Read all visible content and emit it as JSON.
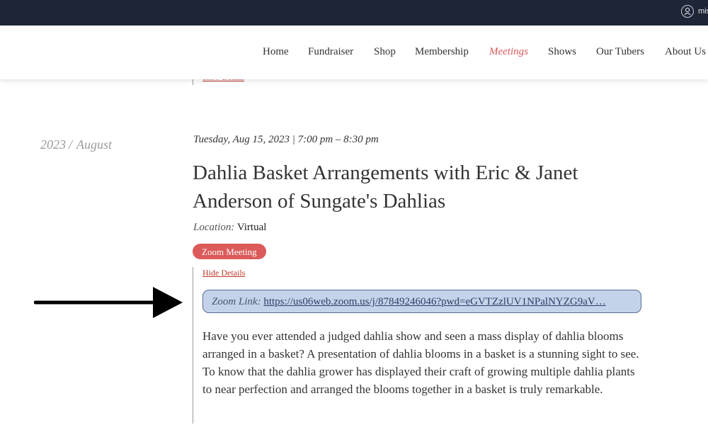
{
  "topbar": {
    "account_text": "mis"
  },
  "nav": {
    "items": [
      {
        "label": "Home"
      },
      {
        "label": "Fundraiser"
      },
      {
        "label": "Shop"
      },
      {
        "label": "Membership"
      },
      {
        "label": "Meetings",
        "active": true
      },
      {
        "label": "Shows"
      },
      {
        "label": "Our Tubers"
      },
      {
        "label": "About Us"
      }
    ]
  },
  "previous_event": {
    "details_link": "Show Details"
  },
  "date_column": {
    "year": "2023",
    "separator": "/",
    "month": "August"
  },
  "event": {
    "datetime": "Tuesday, Aug 15, 2023 | 7:00 pm – 8:30 pm",
    "title": "Dahlia Basket Arrangements with Eric & Janet Anderson of Sungate's Dahlias",
    "location_label": "Location:",
    "location_value": "Virtual",
    "badge": "Zoom Meeting",
    "hide_details": "Hide Details",
    "zoom_label": "Zoom Link:",
    "zoom_url": "https://us06web.zoom.us/j/87849246046?pwd=eGVTZzlUV1NPalNYZG9aV…",
    "description": "Have you ever attended a judged dahlia show and seen a mass display of dahlia blooms arranged in a basket? A presentation of dahlia blooms in a basket is a stunning sight to see. To know that the dahlia grower has displayed their craft of growing multiple dahlia plants to near perfection and arranged the blooms together in a basket is truly remarkable."
  },
  "colors": {
    "topbar": "#1d2536",
    "accent": "#d9565a",
    "badge": "#dc5a5a",
    "zoom_box_bg": "#c5d3ea",
    "zoom_box_border": "#556b91"
  },
  "icons": {
    "account": "user-circle-icon",
    "annotation": "arrow-right-icon"
  }
}
